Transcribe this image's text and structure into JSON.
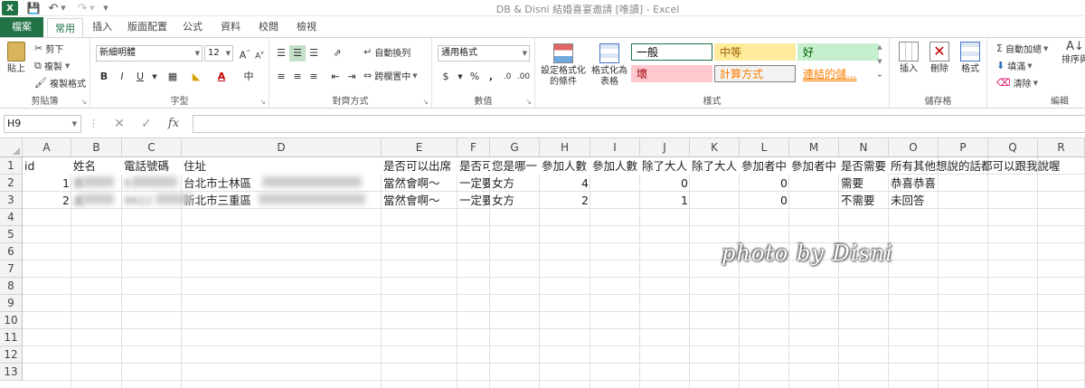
{
  "quick_access": {
    "app_icon": "X",
    "save_icon": "save-icon",
    "undo_icon": "undo-icon",
    "redo_icon": "redo-icon"
  },
  "window": {
    "title": "DB & Disni 結婚喜宴邀請  [唯讀] - Excel"
  },
  "tabs": [
    "檔案",
    "常用",
    "插入",
    "版面配置",
    "公式",
    "資料",
    "校閱",
    "檢視"
  ],
  "ribbon": {
    "clipboard": {
      "label": "剪貼簿",
      "paste": "貼上",
      "cut": "剪下",
      "copy": "複製",
      "format_painter": "複製格式"
    },
    "font": {
      "label": "字型",
      "font_name": "新細明體",
      "font_size": "12",
      "grow": "A",
      "shrink": "A",
      "bold": "B",
      "italic": "I",
      "underline": "U",
      "font_color": "A",
      "phonetic": "中"
    },
    "alignment": {
      "label": "對齊方式",
      "wrap_text": "自動換列",
      "merge_center": "跨欄置中"
    },
    "number": {
      "label": "數值",
      "format": "通用格式",
      "currency": "$",
      "percent": "%",
      "comma": ","
    },
    "styles": {
      "label": "樣式",
      "conditional": "設定格式化的條件",
      "format_table": "格式化為表格",
      "cells": [
        {
          "name": "一般",
          "bg": "#ffffff",
          "fg": "#000000",
          "border": "#217346"
        },
        {
          "name": "中等",
          "bg": "#ffeb9c",
          "fg": "#9c6500",
          "border": "#ffeb9c"
        },
        {
          "name": "好",
          "bg": "#c6efce",
          "fg": "#006100",
          "border": "#c6efce"
        },
        {
          "name": "壞",
          "bg": "#ffc7ce",
          "fg": "#9c0006",
          "border": "#ffc7ce"
        },
        {
          "name": "計算方式",
          "bg": "#f2f2f2",
          "fg": "#fa7d00",
          "border": "#7f7f7f"
        },
        {
          "name": "連結的儲...",
          "bg": "#ffffff",
          "fg": "#fa7d00",
          "border": "#ffffff"
        }
      ]
    },
    "cells": {
      "label": "儲存格",
      "insert": "插入",
      "delete": "刪除",
      "format": "格式"
    },
    "editing": {
      "label": "編輯",
      "autosum": "自動加總",
      "fill": "填滿",
      "clear": "清除",
      "sort": "排序與"
    }
  },
  "formula_bar": {
    "name_box": "H9",
    "fx": "fx",
    "content": ""
  },
  "columns": [
    "A",
    "B",
    "C",
    "D",
    "E",
    "F",
    "G",
    "H",
    "I",
    "J",
    "K",
    "L",
    "M",
    "N",
    "O",
    "P",
    "Q",
    "R"
  ],
  "rows": [
    "1",
    "2",
    "3",
    "4",
    "5",
    "6",
    "7",
    "8",
    "9",
    "10",
    "11",
    "12",
    "13"
  ],
  "sheet": {
    "header": {
      "A": "id",
      "B": "姓名",
      "C": "電話號碼",
      "D": "住址",
      "E": "是否可以出席",
      "F": "是否可",
      "G": "您是哪一",
      "H": "參加人數",
      "I": "參加人數",
      "J": "除了大人",
      "K": "除了大人",
      "L": "參加者中",
      "M": "參加者中",
      "N": "是否需要",
      "O": "所有其他想說的話都可以跟我說喔"
    },
    "row2": {
      "A": "1",
      "B": "蔡",
      "C": "97",
      "D": "台北市士林區",
      "E": "當然會啊～",
      "F": "一定要到",
      "G": "女方",
      "H": "4",
      "J": "0",
      "L": "0",
      "N": "需要",
      "O": "恭喜恭喜"
    },
    "row3": {
      "A": "2",
      "B": "盧",
      "C": "9622",
      "D": "新北市三重區",
      "E": "當然會啊～",
      "F": "一定要到",
      "G": "女方",
      "H": "2",
      "J": "1",
      "L": "0",
      "N": "不需要",
      "O": "未回答"
    }
  },
  "watermark": "photo by Disni"
}
